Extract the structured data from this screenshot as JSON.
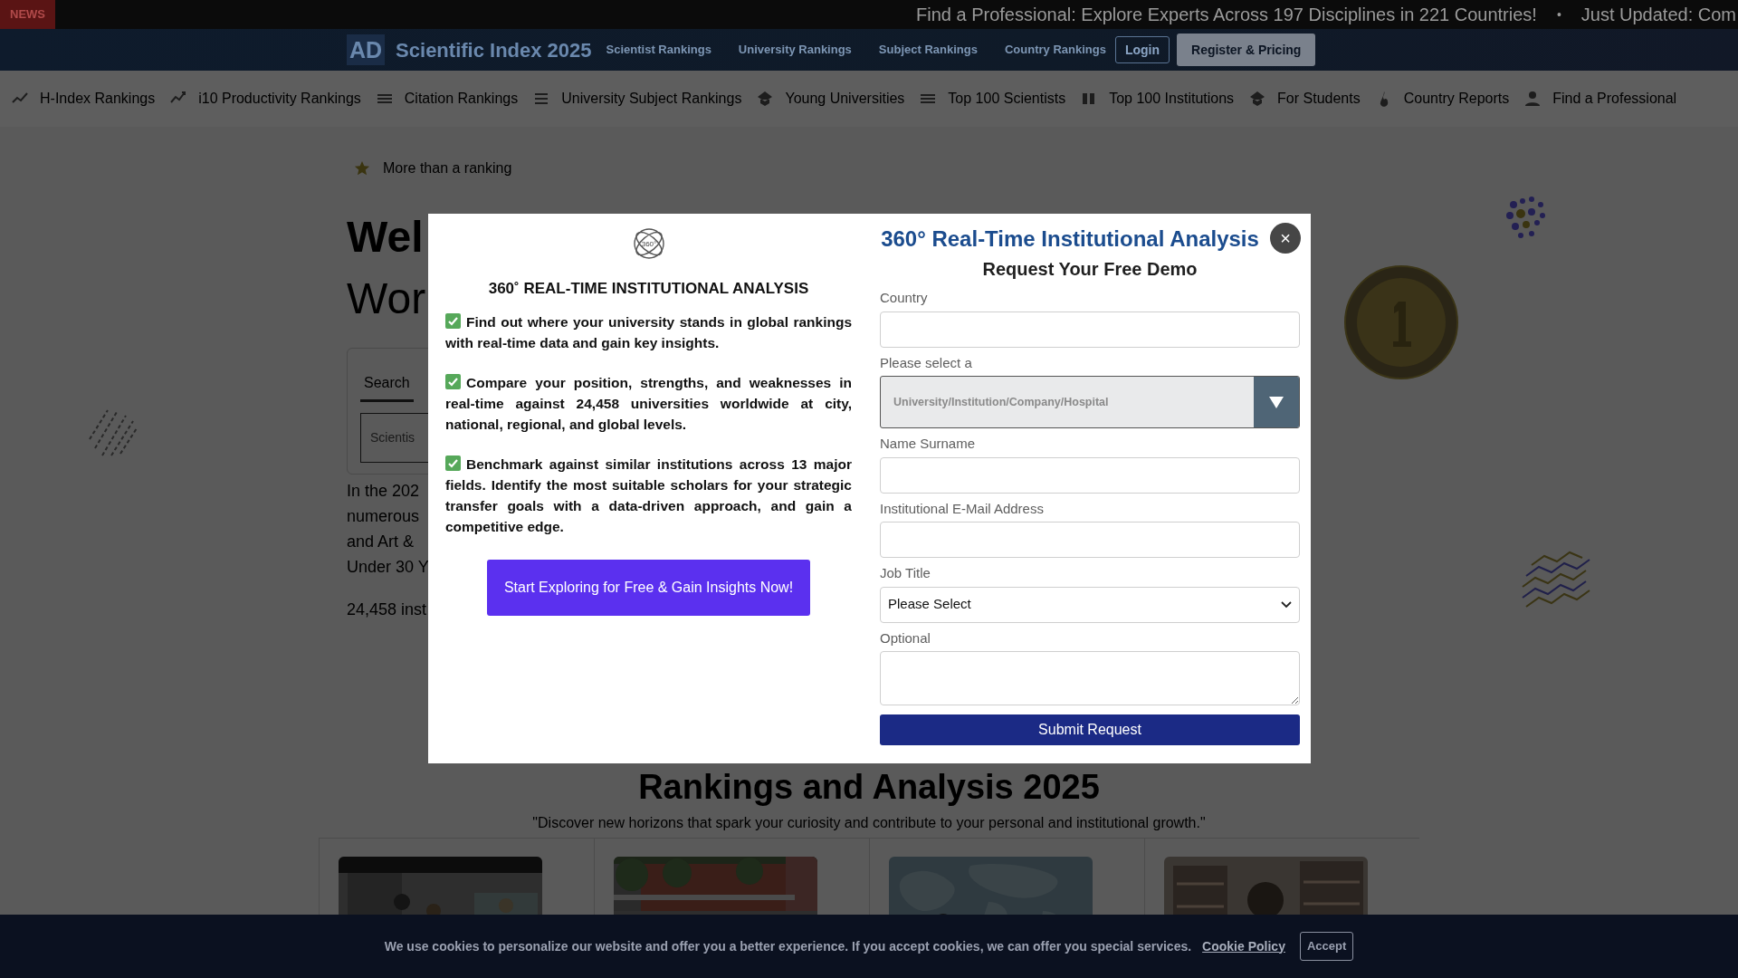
{
  "news_bar": {
    "label": "NEWS",
    "items": [
      "Find a Professional: Explore Experts Across 197 Disciplines in 221 Countries!",
      "Just Updated: Com"
    ],
    "separator": "•"
  },
  "header": {
    "logo": "AD",
    "brand": "Scientific Index 2025",
    "links": [
      "Scientist Rankings",
      "University Rankings",
      "Subject Rankings",
      "Country Rankings"
    ],
    "buttons": [
      {
        "label": "Login",
        "kind": "outline"
      },
      {
        "label": "Register & Pricing",
        "kind": "filled"
      }
    ]
  },
  "subnav": [
    "H-Index Rankings",
    "i10 Productivity Rankings",
    "Citation Rankings",
    "University Subject Rankings",
    "Young Universities",
    "Top 100 Scientists",
    "Top 100 Institutions",
    "For Students",
    "Country Reports",
    "Find a Professional"
  ],
  "hero": {
    "tagline": "More than a ranking",
    "heading_lines": [
      "Wel",
      "Wor"
    ],
    "search_tab": {
      "label": "Search",
      "selected": true
    },
    "search_placeholder": "Scientis",
    "paragraph_lines": [
      "In the 202",
      "numerous",
      "and Art &",
      "Under 30 Y"
    ],
    "count_line": "24,458 inst"
  },
  "section": {
    "heading": "Rankings and Analysis 2025",
    "quote": "\"Discover new horizons that spark your curiosity and contribute to your personal and institutional growth.\""
  },
  "modal": {
    "logo_text": "360°",
    "left_title": "360˚ REAL-TIME INSTITUTIONAL ANALYSIS",
    "points": [
      "Find out where your university stands in global rankings with **real-time** data and gain key insights.",
      "Compare your position, strengths, and weaknesses in **real-time** against 24,458 universities worldwide at city, national, regional, and global levels.",
      "Benchmark against similar institutions across 13 major fields. Identify the most suitable scholars for your **strategic transfer goals** with a data-driven approach, and gain a competitive edge."
    ],
    "cta": "Start Exploring for Free & Gain Insights Now!",
    "title": "360° Real-Time Institutional Analysis",
    "subtitle": "Request Your Free Demo",
    "close": "×",
    "fields": [
      {
        "label": "Country",
        "kind": "text"
      },
      {
        "label": "Please select a",
        "kind": "dropdown",
        "value": "University/Institution/Company/Hospital"
      },
      {
        "label": "Name Surname",
        "kind": "text"
      },
      {
        "label": "Institutional E-Mail Address",
        "kind": "text"
      },
      {
        "label": "Job Title",
        "kind": "select",
        "value": "Please Select"
      },
      {
        "label": "Optional",
        "kind": "textarea"
      }
    ],
    "submit": "Submit Request"
  },
  "cookie": {
    "text": "We use cookies to personalize our website and offer you a better experience. If you accept cookies, we can offer you special services.",
    "link": "Cookie Policy",
    "button": "Accept"
  }
}
